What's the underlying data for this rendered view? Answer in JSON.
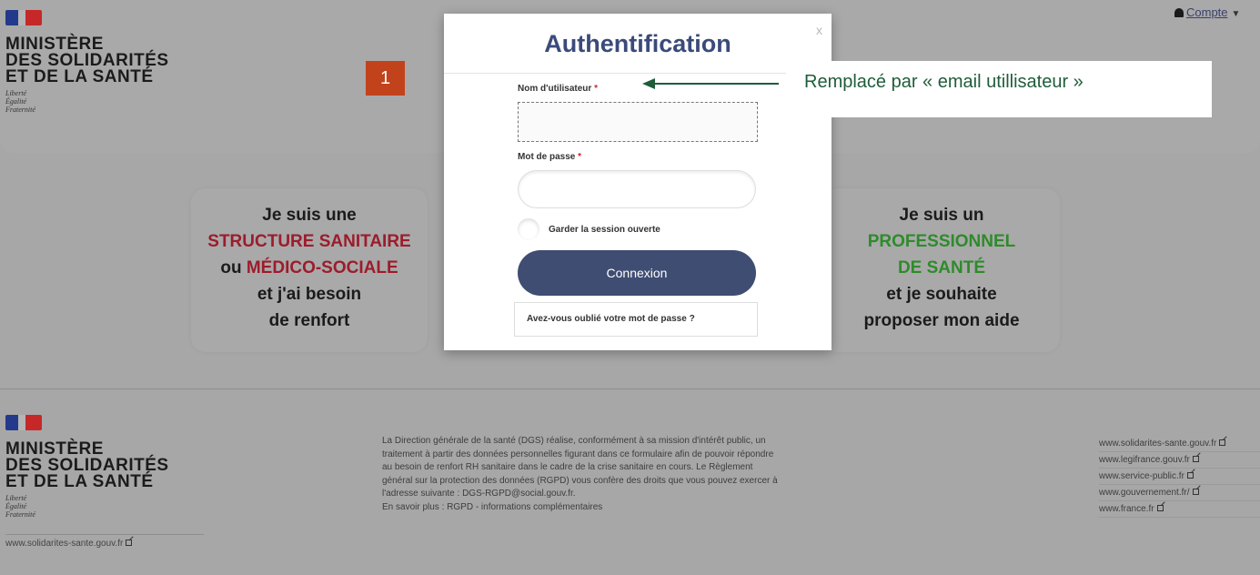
{
  "header": {
    "ministry_lines": [
      "MINISTÈRE",
      "DES SOLIDARITÉS",
      "ET DE LA SANTÉ"
    ],
    "motto_lines": [
      "Liberté",
      "Égalité",
      "Fraternité"
    ],
    "step_badge": "1",
    "account_label": "Compte"
  },
  "cards": {
    "left": {
      "line1": "Je suis une",
      "line2": "STRUCTURE SANITAIRE",
      "line3_prefix": "ou ",
      "line3_highlight": "MÉDICO-SOCIALE",
      "line4": "et j'ai besoin",
      "line5": "de renfort"
    },
    "right": {
      "line1": "Je suis un",
      "line2": "PROFESSIONNEL",
      "line3": "DE SANTÉ",
      "line4": "et je souhaite",
      "line5": "proposer mon aide"
    }
  },
  "modal": {
    "title": "Authentification",
    "close": "x",
    "username_label": "Nom d'utilisateur",
    "password_label": "Mot de passe",
    "required_mark": "*",
    "keep_session_label": "Garder la session ouverte",
    "login_button": "Connexion",
    "forgot_password": "Avez-vous oublié votre mot de passe ?"
  },
  "annotation": {
    "text": "Remplacé par « email utillisateur »",
    "arrow_color": "#1f5d3a"
  },
  "footer": {
    "ministry_lines": [
      "MINISTÈRE",
      "DES SOLIDARITÉS",
      "ET DE LA SANTÉ"
    ],
    "motto_lines": [
      "Liberté",
      "Égalité",
      "Fraternité"
    ],
    "site_url": "www.solidarites-sante.gouv.fr",
    "text_lines": [
      "La Direction générale de la santé (DGS) réalise, conformément à sa mission d'intérêt public, un",
      "traitement à partir des données personnelles figurant dans ce formulaire afin de pouvoir répondre",
      "au besoin de renfort RH sanitaire dans le cadre de la crise sanitaire en cours. Le Règlement",
      "général sur la protection des données (RGPD) vous confère des droits que vous pouvez exercer à",
      "l'adresse suivante : DGS-RGPD@social.gouv.fr.",
      "En savoir plus : RGPD - informations complémentaires"
    ],
    "links": [
      "www.solidarites-sante.gouv.fr",
      "www.legifrance.gouv.fr",
      "www.service-public.fr",
      "www.gouvernement.fr/",
      "www.france.fr"
    ]
  },
  "colors": {
    "brand_blue": "#3a4a7a",
    "button": "#3f4d72",
    "structure_red": "#9c1c2c",
    "professionnel_green": "#2e8b2b",
    "badge": "#c2421c"
  }
}
